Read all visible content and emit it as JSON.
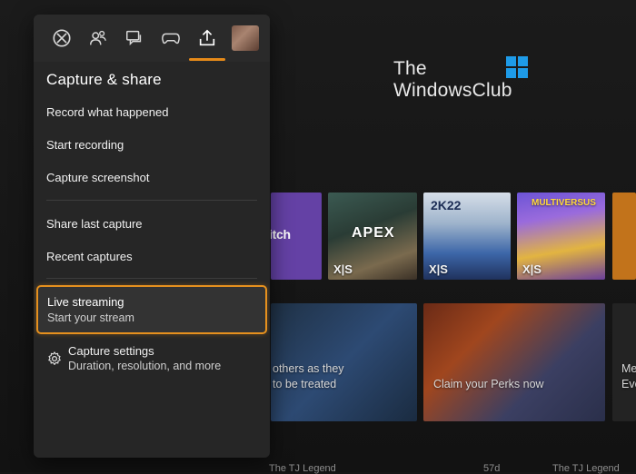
{
  "watermark": {
    "line1": "The",
    "line2": "WindowsClub"
  },
  "guide": {
    "tabs": [
      {
        "icon": "xbox-icon"
      },
      {
        "icon": "people-icon"
      },
      {
        "icon": "messages-icon"
      },
      {
        "icon": "controller-icon"
      },
      {
        "icon": "share-upload-icon",
        "selected": true
      },
      {
        "icon": "profile-avatar"
      }
    ],
    "title": "Capture & share",
    "items": [
      {
        "label": "Record what happened"
      },
      {
        "label": "Start recording"
      },
      {
        "label": "Capture screenshot"
      },
      {
        "label": "Share last capture"
      },
      {
        "label": "Recent captures"
      }
    ],
    "live": {
      "title": "Live streaming",
      "subtitle": "Start your stream"
    },
    "settings": {
      "title": "Capture settings",
      "subtitle": "Duration, resolution, and more"
    }
  },
  "dashboard": {
    "tiles": [
      {
        "name": "twitch",
        "label": "itch"
      },
      {
        "name": "apex",
        "label": "APEX",
        "badge": "X|S"
      },
      {
        "name": "2k22",
        "label": "2K22",
        "badge": "X|S"
      },
      {
        "name": "multiversus",
        "label": "MULTIVERSUS",
        "badge": "X|S"
      }
    ],
    "promos": [
      {
        "line1": "others as they",
        "line2": "to be treated"
      },
      {
        "line1": "Claim your Perks now"
      },
      {
        "line1": "Me",
        "line2": "Eve"
      }
    ],
    "friends": [
      {
        "name": "The TJ Legend"
      },
      {
        "name": "57d"
      },
      {
        "name": "The TJ Legend"
      }
    ]
  },
  "colors": {
    "accent": "#e5901e",
    "panel": "#262626",
    "background": "#151515"
  }
}
